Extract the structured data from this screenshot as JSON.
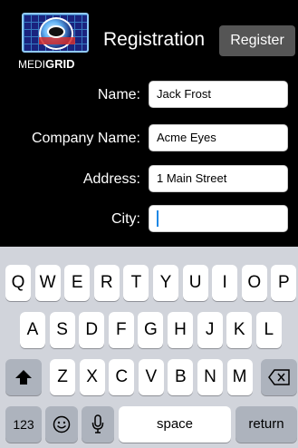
{
  "header": {
    "logo_text_prefix": "MEDI",
    "logo_text_suffix": "GRID",
    "title": "Registration",
    "register_label": "Register"
  },
  "form": {
    "name_label": "Name:",
    "name_value": "Jack Frost",
    "company_label": "Company Name:",
    "company_value": "Acme Eyes",
    "address_label": "Address:",
    "address_value": "1 Main Street",
    "city_label": "City:",
    "city_value": ""
  },
  "keyboard": {
    "row1": [
      "Q",
      "W",
      "E",
      "R",
      "T",
      "Y",
      "U",
      "I",
      "O",
      "P"
    ],
    "row2": [
      "A",
      "S",
      "D",
      "F",
      "G",
      "H",
      "J",
      "K",
      "L"
    ],
    "row3": [
      "Z",
      "X",
      "C",
      "V",
      "B",
      "N",
      "M"
    ],
    "numbers_label": "123",
    "space_label": "space",
    "return_label": "return",
    "icons": {
      "shift": "shift-icon",
      "delete": "backspace-icon",
      "emoji": "emoji-icon",
      "mic": "microphone-icon"
    }
  }
}
